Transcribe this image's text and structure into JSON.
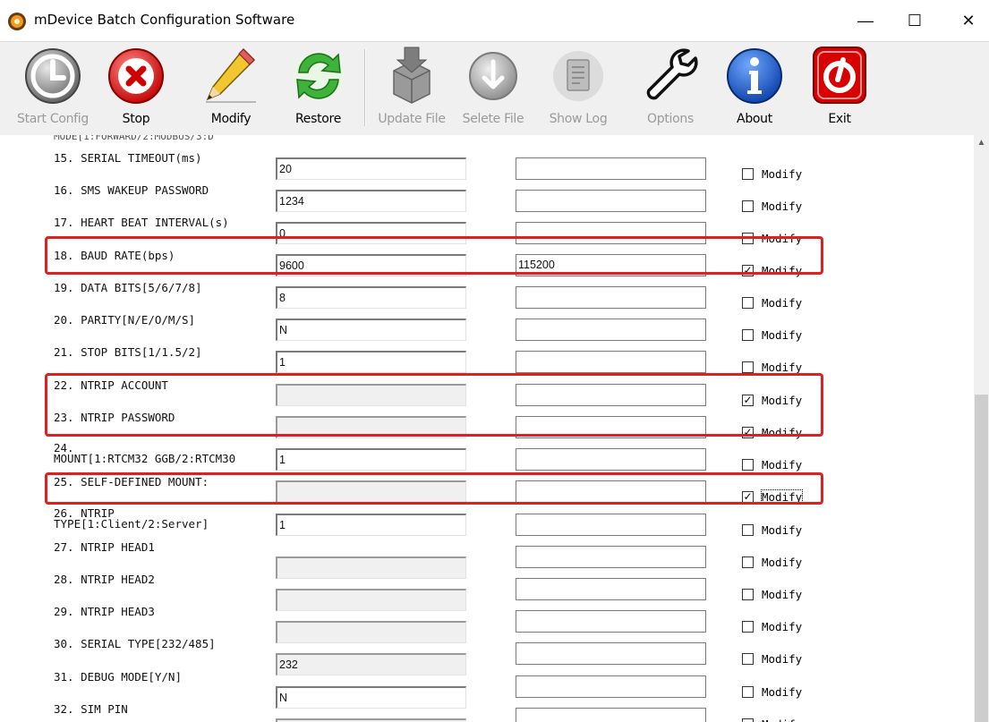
{
  "window": {
    "title": "mDevice Batch Configuration Software",
    "minimize": "—",
    "maximize": "☐",
    "close": "✕"
  },
  "toolbar": [
    {
      "label": "Start Config",
      "icon": "start-config-icon",
      "enabled": false
    },
    {
      "label": "Stop",
      "icon": "stop-icon",
      "enabled": true
    },
    {
      "label": "Modify",
      "icon": "pencil-icon",
      "enabled": true
    },
    {
      "label": "Restore",
      "icon": "restore-icon",
      "enabled": true
    },
    {
      "label": "Update File",
      "icon": "update-file-icon",
      "enabled": false
    },
    {
      "label": "Selete File",
      "icon": "select-file-icon",
      "enabled": false
    },
    {
      "label": "Show Log",
      "icon": "show-log-icon",
      "enabled": false
    },
    {
      "label": "Options",
      "icon": "wrench-icon",
      "enabled": false
    },
    {
      "label": "About",
      "icon": "info-icon",
      "enabled": true
    },
    {
      "label": "Exit",
      "icon": "exit-icon",
      "enabled": true
    }
  ],
  "partial_top_label": "MODE[1:FORWARD/2:MODBUS/3:D",
  "params": [
    {
      "label": "15. SERIAL TIMEOUT(ms)",
      "current": "20",
      "new_value": "",
      "modify": false,
      "current_disabled": false
    },
    {
      "label": "16. SMS WAKEUP PASSWORD",
      "current": "1234",
      "new_value": "",
      "modify": false,
      "current_disabled": false
    },
    {
      "label": "17. HEART BEAT INTERVAL(s)",
      "current": "0",
      "new_value": "",
      "modify": false,
      "current_disabled": false
    },
    {
      "label": "18. BAUD RATE(bps)",
      "current": "9600",
      "new_value": "115200",
      "modify": true,
      "current_disabled": false
    },
    {
      "label": "19. DATA BITS[5/6/7/8]",
      "current": "8",
      "new_value": "",
      "modify": false,
      "current_disabled": false
    },
    {
      "label": "20. PARITY[N/E/O/M/S]",
      "current": "N",
      "new_value": "",
      "modify": false,
      "current_disabled": false
    },
    {
      "label": "21. STOP BITS[1/1.5/2]",
      "current": "1",
      "new_value": "",
      "modify": false,
      "current_disabled": false
    },
    {
      "label": "22. NTRIP ACCOUNT",
      "current": "",
      "new_value": "",
      "modify": true,
      "current_disabled": true
    },
    {
      "label": "23. NTRIP PASSWORD",
      "current": "",
      "new_value": "",
      "modify": true,
      "current_disabled": true
    },
    {
      "label": "24.\nMOUNT[1:RTCM32 GGB/2:RTCM30",
      "current": "1",
      "new_value": "",
      "modify": false,
      "current_disabled": false
    },
    {
      "label": "25. SELF-DEFINED MOUNT:",
      "current": "",
      "new_value": "",
      "modify": true,
      "current_disabled": true
    },
    {
      "label": "26. NTRIP\nTYPE[1:Client/2:Server]",
      "current": "1",
      "new_value": "",
      "modify": false,
      "current_disabled": false
    },
    {
      "label": "27. NTRIP HEAD1",
      "current": "",
      "new_value": "",
      "modify": false,
      "current_disabled": true
    },
    {
      "label": "28. NTRIP HEAD2",
      "current": "",
      "new_value": "",
      "modify": false,
      "current_disabled": true
    },
    {
      "label": "29. NTRIP HEAD3",
      "current": "",
      "new_value": "",
      "modify": false,
      "current_disabled": true
    },
    {
      "label": "30. SERIAL TYPE[232/485]",
      "current": "232",
      "new_value": "",
      "modify": false,
      "current_disabled": true
    },
    {
      "label": "31. DEBUG MODE[Y/N]",
      "current": "N",
      "new_value": "",
      "modify": false,
      "current_disabled": false
    },
    {
      "label": "32. SIM PIN",
      "current": "",
      "new_value": "",
      "modify": false,
      "current_disabled": true
    }
  ],
  "modify_label": "Modify",
  "check_mark": "✓",
  "colors": {
    "highlight": "#e02020"
  }
}
